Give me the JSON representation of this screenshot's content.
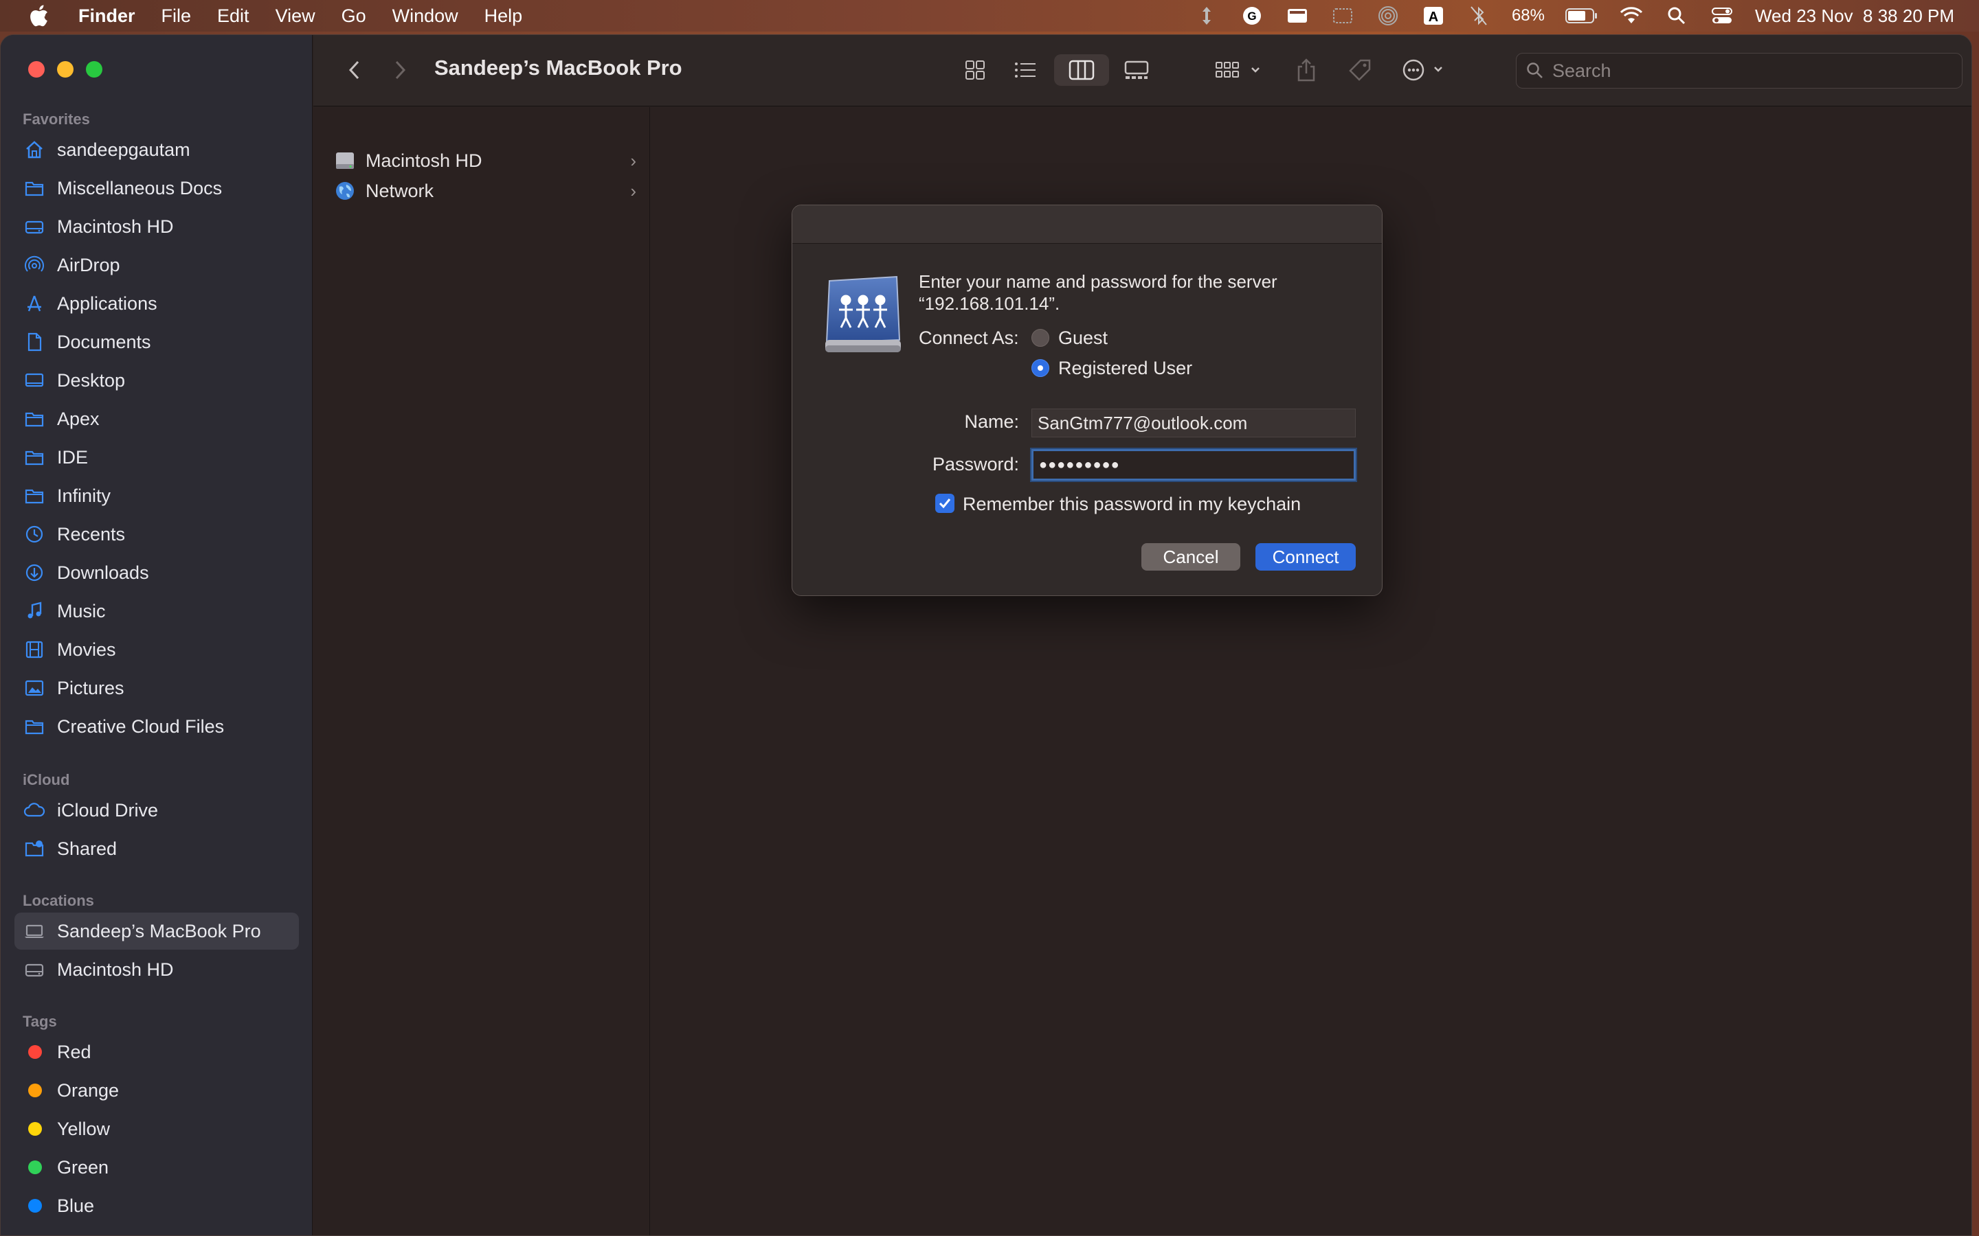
{
  "menubar": {
    "app": "Finder",
    "items": [
      "File",
      "Edit",
      "View",
      "Go",
      "Window",
      "Help"
    ],
    "battery": "68%",
    "datetime": "Wed 23 Nov  8 38 20 PM"
  },
  "window": {
    "title": "Sandeep’s MacBook Pro",
    "search_placeholder": "Search"
  },
  "sidebar": {
    "favorites_label": "Favorites",
    "favorites": [
      {
        "label": "sandeepgautam",
        "icon": "home-icon"
      },
      {
        "label": "Miscellaneous Docs",
        "icon": "folder-icon"
      },
      {
        "label": "Macintosh HD",
        "icon": "drive-icon"
      },
      {
        "label": "AirDrop",
        "icon": "airdrop-icon"
      },
      {
        "label": "Applications",
        "icon": "applications-icon"
      },
      {
        "label": "Documents",
        "icon": "document-icon"
      },
      {
        "label": "Desktop",
        "icon": "desktop-icon"
      },
      {
        "label": "Apex",
        "icon": "folder-icon"
      },
      {
        "label": "IDE",
        "icon": "folder-icon"
      },
      {
        "label": "Infinity",
        "icon": "folder-icon"
      },
      {
        "label": "Recents",
        "icon": "clock-icon"
      },
      {
        "label": "Downloads",
        "icon": "download-icon"
      },
      {
        "label": "Music",
        "icon": "music-icon"
      },
      {
        "label": "Movies",
        "icon": "film-icon"
      },
      {
        "label": "Pictures",
        "icon": "photo-icon"
      },
      {
        "label": "Creative Cloud Files",
        "icon": "folder-icon"
      }
    ],
    "icloud_label": "iCloud",
    "icloud": [
      {
        "label": "iCloud Drive",
        "icon": "cloud-icon"
      },
      {
        "label": "Shared",
        "icon": "shared-folder-icon"
      }
    ],
    "locations_label": "Locations",
    "locations": [
      {
        "label": "Sandeep’s MacBook Pro",
        "icon": "laptop-icon",
        "selected": true
      },
      {
        "label": "Macintosh HD",
        "icon": "drive-icon"
      }
    ],
    "tags_label": "Tags",
    "tags": [
      {
        "label": "Red",
        "color": "#ff453a"
      },
      {
        "label": "Orange",
        "color": "#ff9f0a"
      },
      {
        "label": "Yellow",
        "color": "#ffd60a"
      },
      {
        "label": "Green",
        "color": "#30d158"
      },
      {
        "label": "Blue",
        "color": "#0a84ff"
      }
    ]
  },
  "column": {
    "items": [
      {
        "label": "Macintosh HD",
        "icon": "drive-icon"
      },
      {
        "label": "Network",
        "icon": "globe-icon"
      }
    ]
  },
  "dialog": {
    "message": "Enter your name and password for the server “192.168.101.14”.",
    "connect_as_label": "Connect As:",
    "guest_label": "Guest",
    "registered_label": "Registered User",
    "name_label": "Name:",
    "name_value": "SanGtm777@outlook.com",
    "password_label": "Password:",
    "password_value": "●●●●●●●●●",
    "remember_label": "Remember this password in my keychain",
    "cancel_label": "Cancel",
    "connect_label": "Connect"
  }
}
